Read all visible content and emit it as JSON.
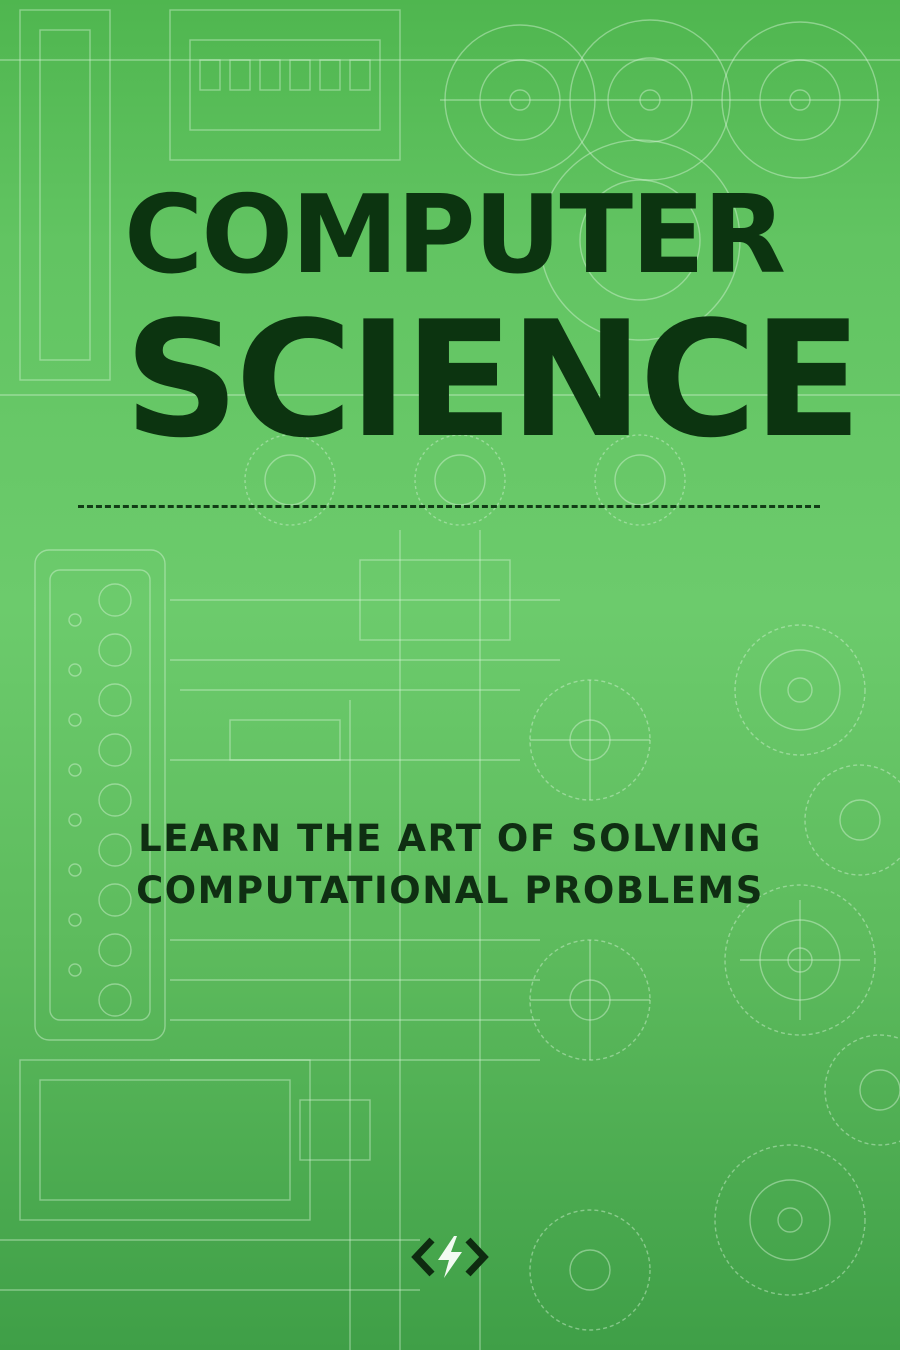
{
  "cover": {
    "title_line_1": "COMPUTER",
    "title_line_2": "SCIENCE",
    "subtitle_line_1": "LEARN THE ART OF SOLVING",
    "subtitle_line_2": "COMPUTATIONAL PROBLEMS",
    "logo_icon": "code-lightning-icon",
    "background_icon": "mechanical-blueprint-gears",
    "colors": {
      "background": "#62c462",
      "title": "#0c3410",
      "subtitle": "#0f2e12",
      "blueprint_lines": "#c8ecc8"
    }
  }
}
